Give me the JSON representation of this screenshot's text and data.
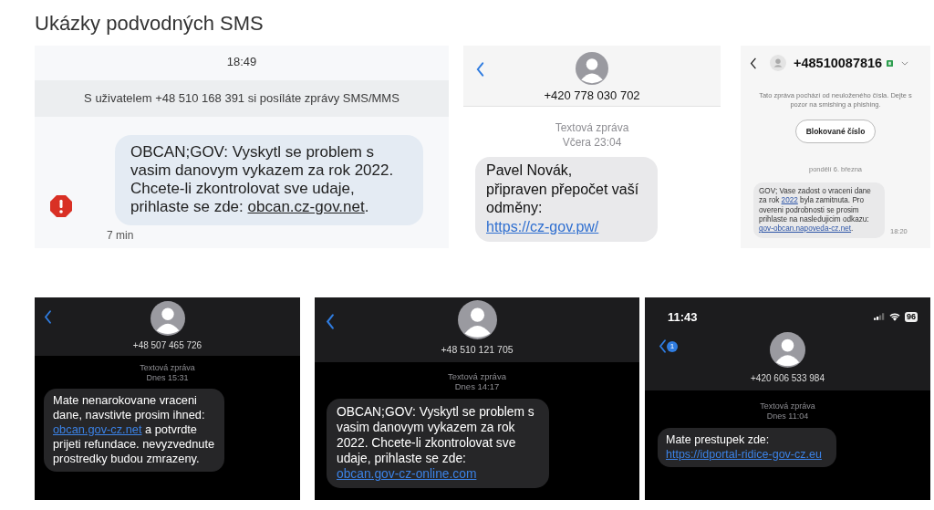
{
  "title": "Ukázky podvodných SMS",
  "screenshots": [
    {
      "kind": "android",
      "time": "18:49",
      "banner": "S uživatelem +48 510 168 391 si posíláte zprávy SMS/MMS",
      "warning": true,
      "timestamp": "7 min",
      "message": [
        {
          "text": "OBCAN;GOV: Vyskytl se problem s vasim danovym vykazem za rok 2022. Chcete-li zkontrolovat sve udaje, prihlaste se zde: ",
          "link": false
        },
        {
          "text": "obcan.cz-gov.net",
          "link": true
        },
        {
          "text": ".",
          "link": false
        }
      ]
    },
    {
      "kind": "ios-light",
      "sender": "+420 778 030 702",
      "label": "Textová zpráva",
      "date": "Včera 23:04",
      "message": [
        {
          "text": "Pavel Novák,\npřipraven přepočet vaší odměny: ",
          "link": false
        },
        {
          "text": "https://cz-gov.pw/",
          "link": true
        }
      ]
    },
    {
      "kind": "samsung",
      "sender": "+48510087816",
      "notice": [
        "Tato zpráva pochází od neuloženého čísla. Dejte s",
        "pozor na smishing a phishing."
      ],
      "button": "Blokované číslo",
      "date": "pondělí 6. března",
      "timestamp": "18:20",
      "message": [
        {
          "text": "GOV; Vase zadost o vraceni dane za rok ",
          "link": false
        },
        {
          "text": "2022",
          "link": true
        },
        {
          "text": " byla zamitnuta. Pro overeni podrobnosti se prosim prihlaste na nasledujicim odkazu: ",
          "link": false
        },
        {
          "text": "gov-obcan.napoveda-cz.net",
          "link": true
        },
        {
          "text": ".",
          "link": false
        }
      ]
    },
    {
      "kind": "ios-dark",
      "sender": "+48 507 465 726",
      "label": "Textová zpráva",
      "date": "Dnes 15:31",
      "message": [
        {
          "text": "Mate nenarokovane vraceni dane, navstivte prosim ihned: ",
          "link": false
        },
        {
          "text": "obcan.gov-cz.net",
          "link": true
        },
        {
          "text": " a potvrdte prijeti refundace. nevyzvednute prostredky budou zmrazeny.",
          "link": false
        }
      ]
    },
    {
      "kind": "ios-dark",
      "sender": "+48 510 121 705",
      "label": "Textová zpráva",
      "date": "Dnes 14:17",
      "message": [
        {
          "text": "OBCAN;GOV: Vyskytl se problem s vasim danovym vykazem za rok 2022. Chcete-li zkontrolovat sve udaje, prihlaste se zde: ",
          "link": false
        },
        {
          "text": "obcan.gov-cz-online.com",
          "link": true
        }
      ]
    },
    {
      "kind": "ios-dark",
      "status": {
        "time": "11:43",
        "battery": "96"
      },
      "back_badge": "1",
      "sender": "+420 606 533 984",
      "label": "Textová zpráva",
      "date": "Dnes 11:04",
      "message": [
        {
          "text": "Mate prestupek zde: ",
          "link": false
        },
        {
          "text": "https://idportal-ridice-gov-cz.eu",
          "link": true
        }
      ]
    }
  ]
}
